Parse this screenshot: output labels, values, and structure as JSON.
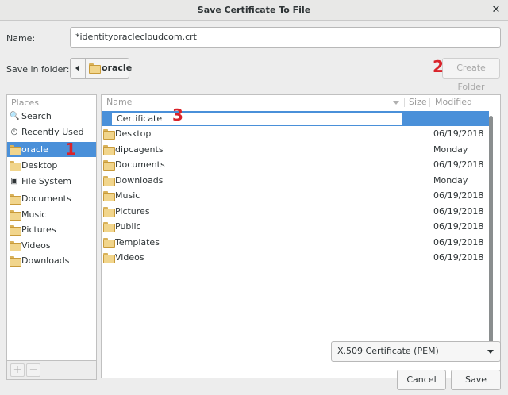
{
  "window": {
    "title": "Save Certificate To File",
    "close_glyph": "✕"
  },
  "name_field": {
    "label": "Name:",
    "value": "*identityoraclecloudcom.crt"
  },
  "save_in": {
    "label": "Save in folder:",
    "path_segment": "oracle"
  },
  "create_folder_label": "Create Folder",
  "sidebar": {
    "heading": "Places",
    "items": [
      {
        "label": "Search",
        "icon": "search-icon"
      },
      {
        "label": "Recently Used",
        "icon": "clock-icon"
      },
      {
        "label": "oracle",
        "icon": "home-folder-icon",
        "selected": true
      },
      {
        "label": "Desktop",
        "icon": "folder-icon"
      },
      {
        "label": "File System",
        "icon": "drive-icon"
      },
      {
        "label": "Documents",
        "icon": "folder-icon"
      },
      {
        "label": "Music",
        "icon": "folder-icon"
      },
      {
        "label": "Pictures",
        "icon": "folder-icon"
      },
      {
        "label": "Videos",
        "icon": "folder-icon"
      },
      {
        "label": "Downloads",
        "icon": "folder-icon"
      }
    ],
    "add_glyph": "+",
    "remove_glyph": "−"
  },
  "file_list": {
    "columns": {
      "name": "Name",
      "size": "Size",
      "modified": "Modified"
    },
    "new_folder_name": "Certificate",
    "rows": [
      {
        "name": "Desktop",
        "modified": "06/19/2018"
      },
      {
        "name": "dipcagents",
        "modified": "Monday"
      },
      {
        "name": "Documents",
        "modified": "06/19/2018"
      },
      {
        "name": "Downloads",
        "modified": "Monday"
      },
      {
        "name": "Music",
        "modified": "06/19/2018"
      },
      {
        "name": "Pictures",
        "modified": "06/19/2018"
      },
      {
        "name": "Public",
        "modified": "06/19/2018"
      },
      {
        "name": "Templates",
        "modified": "06/19/2018"
      },
      {
        "name": "Videos",
        "modified": "06/19/2018"
      }
    ]
  },
  "file_type": {
    "selected": "X.509 Certificate (PEM)"
  },
  "buttons": {
    "cancel": "Cancel",
    "save": "Save"
  },
  "markers": {
    "one": "1",
    "two": "2",
    "three": "3"
  },
  "colors": {
    "selection": "#4a90d9",
    "marker": "#d9232a"
  }
}
